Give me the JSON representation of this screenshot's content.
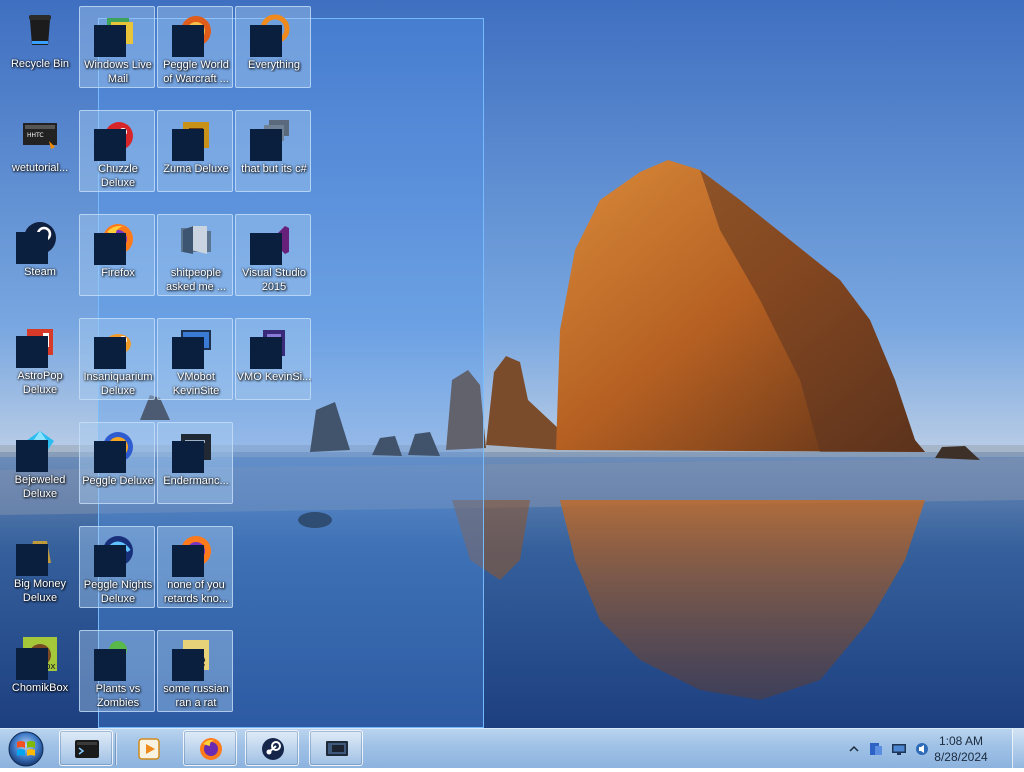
{
  "desktop": {
    "icons": [
      {
        "id": "recycle-bin",
        "label": "Recycle Bin",
        "icon": "recycle-bin-icon",
        "selected": false,
        "masked": false
      },
      {
        "id": "wetutorial",
        "label": "wetutorial...",
        "icon": "video-file-icon",
        "selected": false,
        "masked": false
      },
      {
        "id": "steam",
        "label": "Steam",
        "icon": "steam-icon",
        "selected": false,
        "masked": true
      },
      {
        "id": "astropop",
        "label": "AstroPop Deluxe",
        "icon": "astropop-icon",
        "selected": false,
        "masked": true
      },
      {
        "id": "bejeweled",
        "label": "Bejeweled Deluxe",
        "icon": "gem-icon",
        "selected": false,
        "masked": true
      },
      {
        "id": "big-money",
        "label": "Big Money Deluxe",
        "icon": "money-bag-icon",
        "selected": false,
        "masked": true
      },
      {
        "id": "chomikbox",
        "label": "ChomikBox",
        "icon": "chomik-icon",
        "selected": false,
        "masked": true
      },
      {
        "id": "windows-live-mail",
        "label": "Windows Live Mail",
        "icon": "mail-icon",
        "selected": true,
        "masked": true
      },
      {
        "id": "chuzzle",
        "label": "Chuzzle Deluxe",
        "icon": "chuzzle-icon",
        "selected": true,
        "masked": true
      },
      {
        "id": "firefox",
        "label": "Firefox",
        "icon": "firefox-icon",
        "selected": true,
        "masked": true
      },
      {
        "id": "insaniquarium",
        "label": "Insaniquarium Deluxe",
        "icon": "fish-icon",
        "selected": true,
        "masked": true
      },
      {
        "id": "peggle-deluxe",
        "label": "Peggle Deluxe",
        "icon": "peggle-icon",
        "selected": true,
        "masked": true
      },
      {
        "id": "peggle-nights",
        "label": "Peggle Nights Deluxe",
        "icon": "peggle-nights-icon",
        "selected": true,
        "masked": true
      },
      {
        "id": "plants-vs-zombies",
        "label": "Plants vs Zombies",
        "icon": "plant-icon",
        "selected": true,
        "masked": true
      },
      {
        "id": "peggle-wow",
        "label": "Peggle World of Warcraft ...",
        "icon": "peggle-wow-icon",
        "selected": true,
        "masked": true
      },
      {
        "id": "zuma",
        "label": "Zuma Deluxe",
        "icon": "zuma-icon",
        "selected": true,
        "masked": true
      },
      {
        "id": "shitpeople",
        "label": "shitpeople asked me ...",
        "icon": "folder-icon",
        "selected": true,
        "masked": false
      },
      {
        "id": "vmobot",
        "label": "VMobot KevinSite",
        "icon": "monitor-icon",
        "selected": true,
        "masked": true
      },
      {
        "id": "endermanch",
        "label": "Endermanc...",
        "icon": "app-window-icon",
        "selected": true,
        "masked": true
      },
      {
        "id": "none-of-you",
        "label": "none of you retards kno...",
        "icon": "firefox-shortcut-icon",
        "selected": true,
        "masked": true
      },
      {
        "id": "russian-rat",
        "label": "some russian ran a rat",
        "icon": "text-file-icon",
        "selected": true,
        "masked": true
      },
      {
        "id": "everything",
        "label": "Everything",
        "icon": "everything-search-icon",
        "selected": true,
        "masked": true
      },
      {
        "id": "that-but-csharp",
        "label": "that but its c#",
        "icon": "stacked-windows-icon",
        "selected": true,
        "masked": true
      },
      {
        "id": "visual-studio",
        "label": "Visual Studio 2015",
        "icon": "visual-studio-icon",
        "selected": true,
        "masked": true
      },
      {
        "id": "vmo-kevinsite",
        "label": "VMO KevinSi...",
        "icon": "vm-icon",
        "selected": true,
        "masked": true
      }
    ]
  },
  "taskbar": {
    "start_icon": "windows-start-orb-icon",
    "pinned": [
      {
        "id": "terminal",
        "icon": "terminal-icon"
      },
      {
        "id": "media-player",
        "icon": "media-player-icon"
      },
      {
        "id": "firefox",
        "icon": "firefox-icon"
      },
      {
        "id": "steam",
        "icon": "steam-icon"
      },
      {
        "id": "screen",
        "icon": "screen-capture-icon"
      }
    ],
    "tray": {
      "icons": [
        "show-hidden-icons-chevron-icon",
        "network-app-icon",
        "monitor-tray-icon",
        "volume-icon"
      ],
      "time": "1:08 AM",
      "date": "8/28/2024"
    }
  },
  "colors": {
    "selection_fill": "#5096eb",
    "taskbar": "#a8c8ea",
    "mask": "#0a1f3d"
  }
}
